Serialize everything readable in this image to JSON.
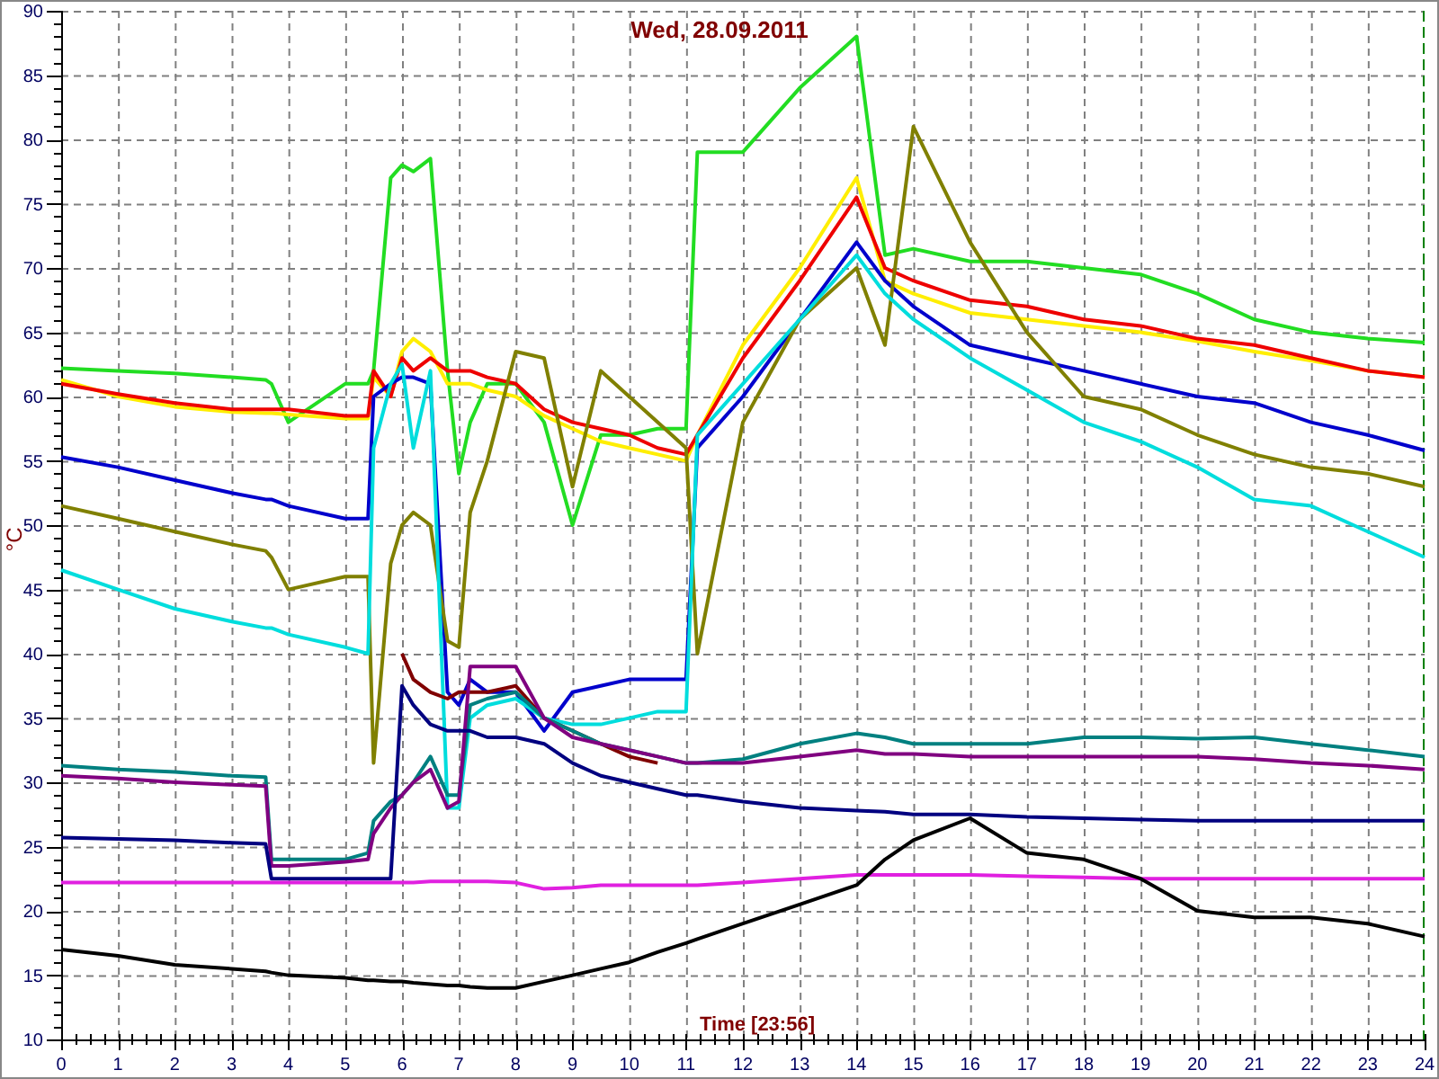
{
  "chart_data": {
    "type": "line",
    "title": "Wed, 28.09.2011",
    "xlabel": "Time [23:56]",
    "ylabel": "°C",
    "grid": true,
    "xlim": [
      0,
      24
    ],
    "ylim": [
      10,
      90
    ],
    "xticks": [
      0,
      1,
      2,
      3,
      4,
      5,
      6,
      7,
      8,
      9,
      10,
      11,
      12,
      13,
      14,
      15,
      16,
      17,
      18,
      19,
      20,
      21,
      22,
      23,
      24
    ],
    "yticks": [
      10,
      15,
      20,
      25,
      30,
      35,
      40,
      45,
      50,
      55,
      60,
      65,
      70,
      75,
      80,
      85,
      90
    ],
    "x": [
      0,
      1,
      2,
      3,
      3.6,
      3.7,
      4,
      5,
      5.4,
      5.5,
      5.8,
      6,
      6.2,
      6.5,
      6.8,
      7,
      7.2,
      7.5,
      8,
      8.5,
      9,
      9.5,
      10,
      10.5,
      11,
      11.2,
      12,
      13,
      14,
      14.5,
      15,
      16,
      17,
      18,
      19,
      20,
      21,
      22,
      23,
      24
    ],
    "series": [
      {
        "color": "#22dd22",
        "values": [
          62.2,
          62,
          61.8,
          61.5,
          61.3,
          61,
          58,
          61,
          61,
          62,
          77,
          78,
          77.5,
          78.5,
          62,
          54,
          58,
          61,
          61,
          58,
          50,
          57,
          57,
          57.5,
          57.5,
          79,
          79,
          84,
          88,
          71,
          71.5,
          70.5,
          70.5,
          70,
          69.5,
          68,
          66,
          65,
          64.5,
          64.2
        ]
      },
      {
        "color": "#ffee00",
        "values": [
          61.3,
          60,
          59.2,
          58.8,
          58.7,
          58.7,
          58.6,
          58.3,
          58.3,
          61.5,
          60,
          63.5,
          64.5,
          63.5,
          61,
          61,
          61,
          60.5,
          60,
          58.5,
          57.5,
          56.5,
          56,
          55.5,
          55,
          57,
          64,
          70,
          77,
          69,
          68,
          66.5,
          66,
          65.5,
          65,
          64.3,
          63.5,
          62.8,
          62,
          61.5
        ]
      },
      {
        "color": "#ee0000",
        "values": [
          61,
          60.2,
          59.5,
          59,
          59,
          59,
          59,
          58.5,
          58.5,
          62,
          60,
          63,
          62,
          63,
          62,
          62,
          62,
          61.5,
          61,
          59,
          58,
          57.5,
          57,
          56,
          55.5,
          57,
          63,
          69,
          75.5,
          70,
          69,
          67.5,
          67,
          66,
          65.5,
          64.5,
          64,
          63,
          62,
          61.5
        ]
      },
      {
        "color": "#0000cc",
        "values": [
          55.3,
          54.5,
          53.5,
          52.5,
          52,
          52,
          51.5,
          50.5,
          50.5,
          60,
          61,
          61.5,
          61.5,
          61,
          37,
          36,
          38,
          37,
          37,
          34,
          37,
          37.5,
          38,
          38,
          38,
          56,
          60,
          66,
          72,
          69,
          67,
          64,
          63,
          62,
          61,
          60,
          59.5,
          58,
          57,
          55.8
        ]
      },
      {
        "color": "#808000",
        "values": [
          51.5,
          50.5,
          49.5,
          48.5,
          48,
          47.5,
          45,
          46,
          46,
          31.5,
          47,
          50,
          51,
          50,
          41,
          40.5,
          51,
          55,
          63.5,
          63,
          53,
          62,
          60,
          58,
          56,
          40,
          58,
          66,
          70,
          64,
          81,
          72,
          65,
          60,
          59,
          57,
          55.5,
          54.5,
          54,
          53
        ]
      },
      {
        "color": "#00dddd",
        "values": [
          46.5,
          45,
          43.5,
          42.5,
          42,
          42,
          41.5,
          40.5,
          40,
          56,
          61,
          62.5,
          56,
          62,
          28,
          28,
          35,
          36,
          36.5,
          35,
          34.5,
          34.5,
          35,
          35.5,
          35.5,
          57,
          61,
          66,
          71,
          68,
          66,
          63,
          60.5,
          58,
          56.5,
          54.5,
          52,
          51.5,
          49.5,
          47.5
        ]
      },
      {
        "color": "#800000",
        "values": [
          null,
          null,
          null,
          null,
          null,
          null,
          null,
          null,
          null,
          null,
          null,
          40,
          38,
          37,
          36.5,
          37,
          37,
          37,
          37.5,
          35,
          34,
          33,
          32,
          31.5,
          null,
          null,
          null,
          null,
          null,
          null,
          null,
          null,
          null,
          null,
          null,
          null,
          null,
          null,
          null,
          null
        ]
      },
      {
        "color": "#008080",
        "values": [
          31.3,
          31,
          30.8,
          30.5,
          30.4,
          24,
          24,
          24,
          24.5,
          27,
          28.5,
          29,
          30,
          32,
          29,
          29,
          36,
          36.5,
          37,
          35,
          34,
          33,
          32.5,
          32,
          31.5,
          31.5,
          31.8,
          33,
          33.8,
          33.5,
          33,
          33,
          33,
          33.5,
          33.5,
          33.4,
          33.5,
          33,
          32.5,
          32
        ]
      },
      {
        "color": "#800080",
        "values": [
          30.5,
          30.3,
          30,
          29.8,
          29.7,
          23.5,
          23.5,
          23.8,
          24,
          26,
          28,
          29,
          30,
          31,
          28,
          28.5,
          39,
          39,
          39,
          35,
          33.5,
          33,
          32.5,
          32,
          31.5,
          31.5,
          31.5,
          32,
          32.5,
          32.2,
          32.2,
          32,
          32,
          32,
          32,
          32,
          31.8,
          31.5,
          31.3,
          31
        ]
      },
      {
        "color": "#000080",
        "values": [
          25.7,
          25.6,
          25.5,
          25.3,
          25.2,
          22.5,
          22.5,
          22.5,
          22.5,
          22.5,
          22.5,
          37.5,
          36,
          34.5,
          34,
          34,
          34,
          33.5,
          33.5,
          33,
          31.5,
          30.5,
          30,
          29.5,
          29,
          29,
          28.5,
          28,
          27.8,
          27.7,
          27.5,
          27.5,
          27.3,
          27.2,
          27.1,
          27,
          27,
          27,
          27,
          27
        ]
      },
      {
        "color": "#e020e0",
        "values": [
          22.2,
          22.2,
          22.2,
          22.2,
          22.2,
          22.2,
          22.2,
          22.2,
          22.2,
          22.2,
          22.2,
          22.2,
          22.2,
          22.3,
          22.3,
          22.3,
          22.3,
          22.3,
          22.2,
          21.7,
          21.8,
          22,
          22,
          22,
          22,
          22,
          22.2,
          22.5,
          22.8,
          22.8,
          22.8,
          22.8,
          22.7,
          22.6,
          22.5,
          22.5,
          22.5,
          22.5,
          22.5,
          22.5
        ]
      },
      {
        "color": "#000000",
        "values": [
          17,
          16.5,
          15.8,
          15.5,
          15.3,
          15.2,
          15,
          14.8,
          14.6,
          14.6,
          14.5,
          14.5,
          14.4,
          14.3,
          14.2,
          14.2,
          14.1,
          14,
          14,
          14.5,
          15,
          15.5,
          16,
          16.8,
          17.5,
          17.8,
          19,
          20.5,
          22,
          24,
          25.5,
          27.2,
          24.5,
          24,
          22.5,
          20,
          19.5,
          19.5,
          19,
          18
        ]
      }
    ]
  }
}
